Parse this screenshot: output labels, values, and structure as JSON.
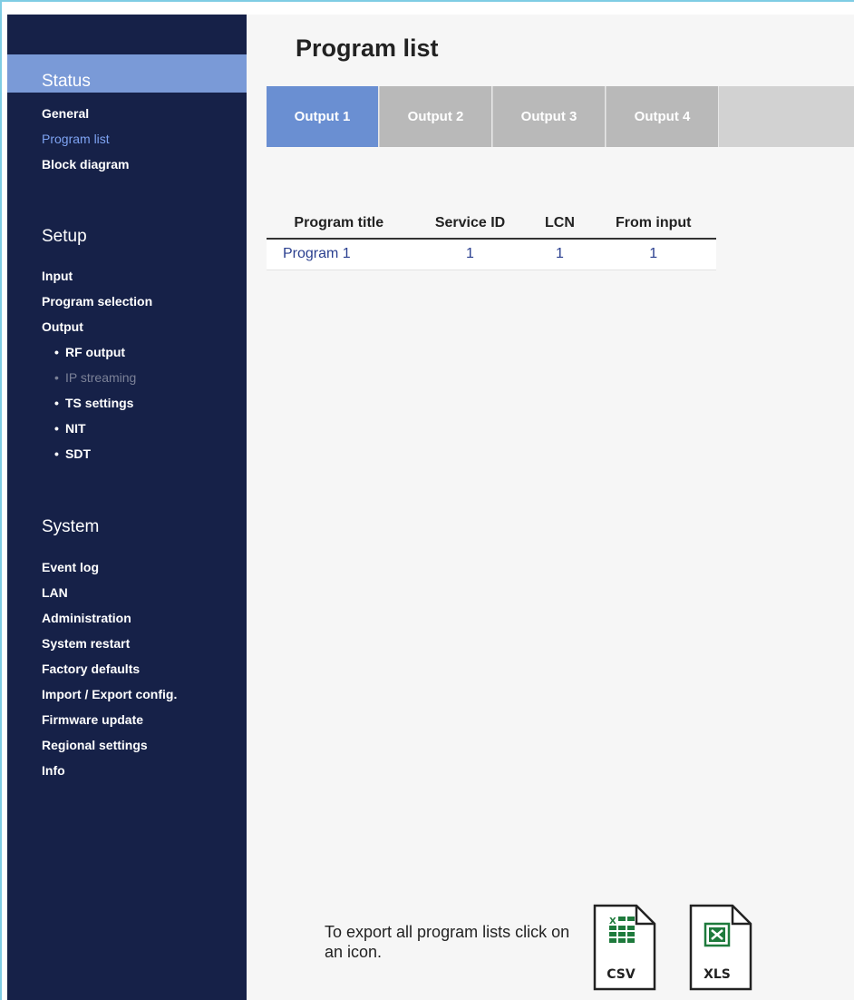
{
  "sidebar": {
    "status": {
      "heading": "Status",
      "items": [
        "General",
        "Program list",
        "Block diagram"
      ]
    },
    "setup": {
      "heading": "Setup",
      "items": [
        "Input",
        "Program selection",
        "Output"
      ],
      "output_subitems": [
        "RF output",
        "IP streaming",
        "TS settings",
        "NIT",
        "SDT"
      ]
    },
    "system": {
      "heading": "System",
      "items": [
        "Event log",
        "LAN",
        "Administration",
        "System restart",
        "Factory defaults",
        "Import / Export config.",
        "Firmware update",
        "Regional settings",
        "Info"
      ]
    }
  },
  "main": {
    "title": "Program list",
    "tabs": [
      "Output 1",
      "Output 2",
      "Output 3",
      "Output 4"
    ],
    "table": {
      "headers": [
        "Program title",
        "Service ID",
        "LCN",
        "From input"
      ],
      "rows": [
        [
          "Program 1",
          "1",
          "1",
          "1"
        ]
      ]
    },
    "export": {
      "text": "To export all program lists click on an icon.",
      "csv_label": "CSV",
      "xls_label": "XLS"
    }
  },
  "colors": {
    "sidebar_bg": "#162148",
    "active_accent": "#6a8fd2",
    "link": "#2a3f8f",
    "excel_green": "#1e7a3c"
  }
}
